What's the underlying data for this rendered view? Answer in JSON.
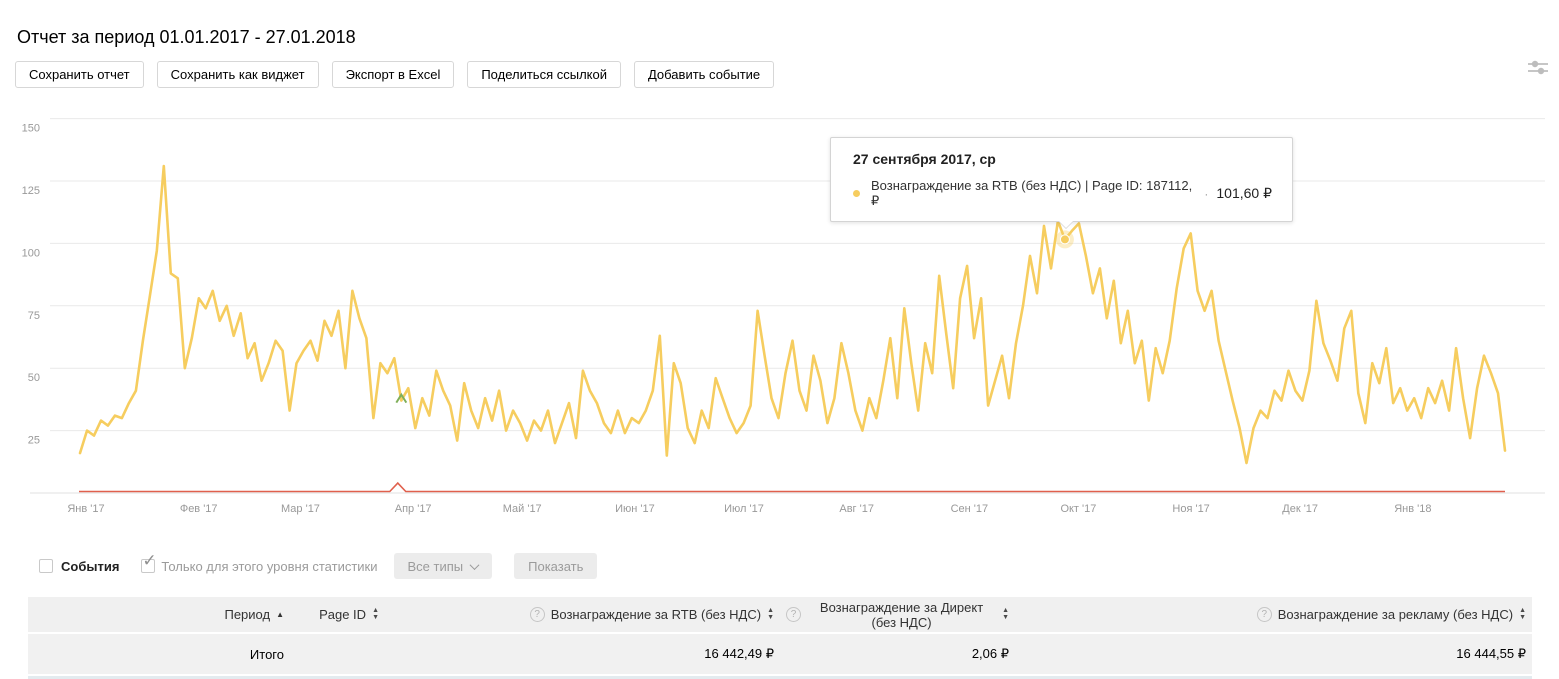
{
  "page": {
    "title": "Отчет за период 01.01.2017 - 27.01.2018"
  },
  "toolbar": {
    "buttons": [
      "Сохранить отчет",
      "Сохранить как виджет",
      "Экспорт в Excel",
      "Поделиться ссылкой",
      "Добавить событие"
    ],
    "settings_icon": "filter-sliders-icon"
  },
  "chart_data": {
    "type": "line",
    "title": "",
    "xlabel": "",
    "ylabel": "",
    "ylim": [
      0,
      150
    ],
    "yticks": [
      150,
      125,
      100,
      75,
      50,
      25
    ],
    "x_tick_labels": [
      "Янв '17",
      "Фев '17",
      "Мар '17",
      "Апр '17",
      "Май '17",
      "Июн '17",
      "Июл '17",
      "Авг '17",
      "Сен '17",
      "Окт '17",
      "Ноя '17",
      "Дек '17",
      "Янв '18"
    ],
    "grid": true,
    "legend": "none",
    "series": [
      {
        "name": "Вознаграждение за RTB (без НДС) | Page ID: 187112, ₽",
        "color": "#f6cd5f",
        "hover_index": 141,
        "values": [
          16,
          25,
          23,
          29,
          27,
          31,
          30,
          36,
          41,
          61,
          79,
          97,
          131,
          88,
          86,
          50,
          62,
          78,
          74,
          81,
          69,
          75,
          63,
          72,
          54,
          60,
          45,
          52,
          61,
          57,
          33,
          52,
          57,
          61,
          53,
          69,
          63,
          73,
          50,
          81,
          70,
          62,
          30,
          52,
          48,
          54,
          37,
          42,
          26,
          38,
          31,
          49,
          41,
          35,
          21,
          44,
          33,
          26,
          38,
          29,
          41,
          25,
          33,
          28,
          21,
          29,
          25,
          33,
          20,
          28,
          36,
          22,
          49,
          41,
          36,
          28,
          24,
          33,
          24,
          30,
          28,
          33,
          41,
          63,
          15,
          52,
          44,
          26,
          20,
          33,
          26,
          46,
          38,
          30,
          24,
          28,
          35,
          73,
          55,
          38,
          30,
          48,
          61,
          41,
          33,
          55,
          45,
          28,
          38,
          60,
          48,
          33,
          25,
          38,
          30,
          45,
          62,
          38,
          74,
          52,
          33,
          60,
          48,
          87,
          64,
          42,
          78,
          91,
          62,
          78,
          35,
          45,
          55,
          38,
          60,
          75,
          95,
          80,
          107,
          90,
          109,
          101.6,
          105,
          108,
          95,
          80,
          90,
          70,
          85,
          60,
          73,
          52,
          61,
          37,
          58,
          48,
          61,
          82,
          98,
          104,
          81,
          73,
          81,
          61,
          49,
          37,
          26,
          12,
          26,
          33,
          30,
          41,
          37,
          49,
          41,
          37,
          49,
          77,
          60,
          53,
          45,
          66,
          73,
          40,
          28,
          52,
          44,
          58,
          36,
          42,
          33,
          38,
          30,
          42,
          36,
          45,
          33,
          58,
          38,
          22,
          42,
          55,
          48,
          40,
          17
        ]
      },
      {
        "name": "Вознаграждение за Директ (без НДС)",
        "color": "#e0604d",
        "baseline_value": 0.4,
        "spike": {
          "x_fraction": 0.223,
          "value": 4
        }
      }
    ],
    "event_marker": {
      "color": "#7faf5a",
      "point_index": 46
    }
  },
  "tooltip": {
    "title": "27 сентября 2017, ср",
    "series_label": "Вознаграждение за RTB (без НДС) | Page ID: 187112, ₽",
    "separator": "·",
    "value": "101,60 ₽",
    "marker_color": "#f6cd5f"
  },
  "events_bar": {
    "events_label": "События",
    "only_level_label": "Только для этого уровня статистики",
    "types_dropdown": "Все типы",
    "show_button": "Показать"
  },
  "table": {
    "headers": [
      {
        "label": "Период",
        "sort": "asc",
        "help": false
      },
      {
        "label": "Page ID",
        "sort": "both",
        "help": false
      },
      {
        "label": "Вознаграждение за RTB (без НДС)",
        "sort": "both",
        "help": true
      },
      {
        "label": "Вознаграждение за Директ (без НДС)",
        "sort": "both",
        "help": true
      },
      {
        "label": "Вознаграждение за рекламу (без НДС)",
        "sort": "both",
        "help": true
      }
    ],
    "totals_row": {
      "label": "Итого",
      "page_id": "",
      "rtb": "16 442,49 ₽",
      "direct": "2,06 ₽",
      "ads": "16 444,55 ₽"
    }
  }
}
